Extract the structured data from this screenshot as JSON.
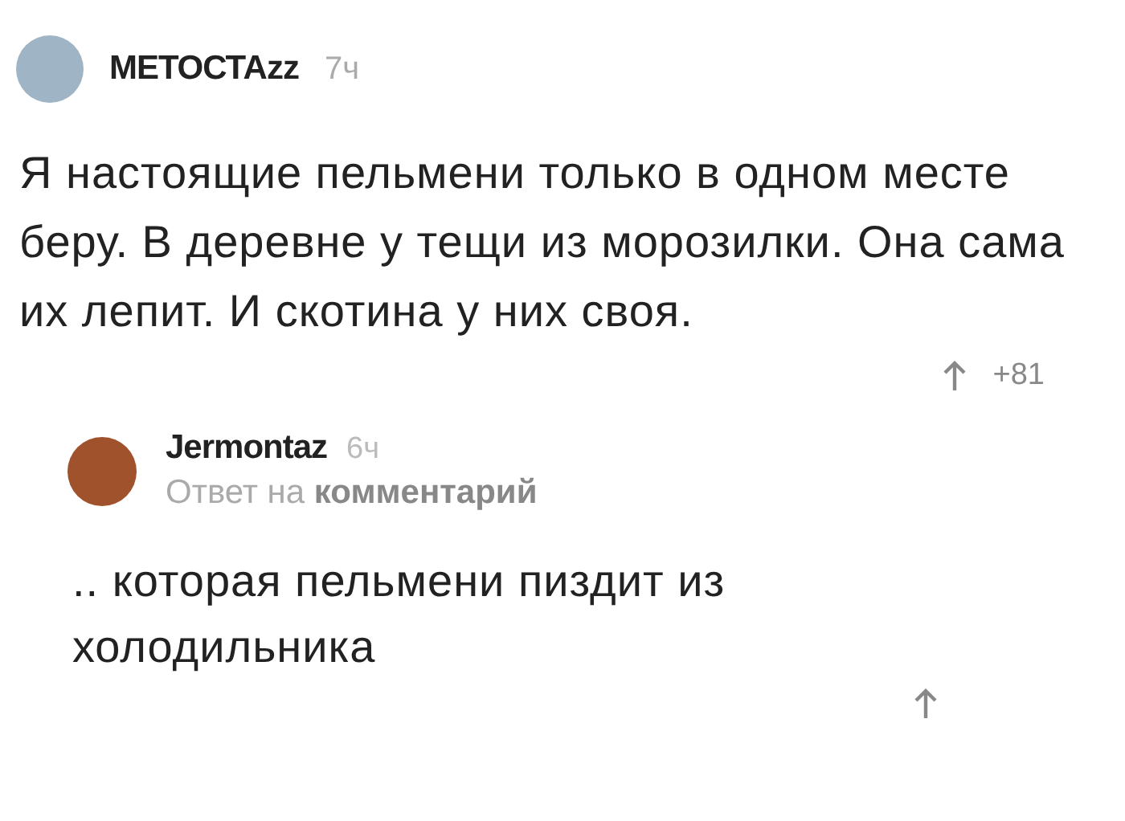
{
  "comment": {
    "author": "МЕТОСТАzz",
    "time": "7ч",
    "text": "Я настоящие пельмени только в одном месте беру. В деревне у тещи из морозилки. Она сама их лепит. И скотина у них своя.",
    "votes": "+81",
    "replies": [
      {
        "author": "Jermontaz",
        "time": "6ч",
        "subtitle": "Ответ на **комментарий**",
        "text": ".. которая пельмени пиздит из холодильника"
      }
    ]
  }
}
